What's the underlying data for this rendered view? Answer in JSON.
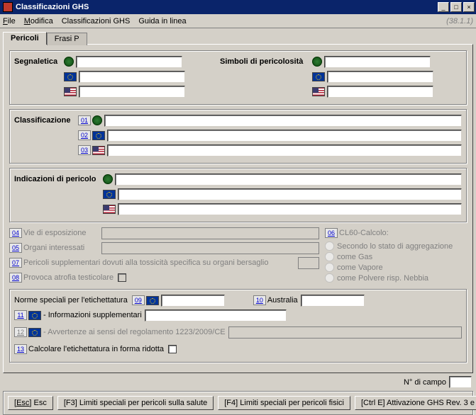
{
  "window": {
    "title": "Classificazioni GHS",
    "version": "(38.1.1)"
  },
  "menu": {
    "file": "File",
    "edit": "Modifica",
    "ghs": "Classificazioni GHS",
    "help": "Guida in linea"
  },
  "tabs": {
    "pericoli": "Pericoli",
    "frasip": "Frasi P"
  },
  "labels": {
    "segnaletica": "Segnaletica",
    "simboli": "Simboli di pericolosità",
    "classificazione": "Classificazione",
    "indicazioni": "Indicazioni di pericolo",
    "vie": "Vie di esposizione",
    "organi": "Organi interessati",
    "perisup": "Pericoli supplementari dovuti alla tossicità specifica su organi bersaglio",
    "provoca": "Provoca atrofia testicolare",
    "cl60": "CL60-Calcolo:",
    "rad1": "Secondo lo stato di aggregazione",
    "rad2": "come Gas",
    "rad3": "come Vapore",
    "rad4": "come Polvere risp. Nebbia",
    "norme": "Norme speciali per l'etichettatura",
    "australia": "Australia",
    "infosup": "- Informazioni supplementari",
    "avvert": "- Avvertenze ai sensi del regolamento 1223/2009/CE",
    "calcrid": "Calcolare l'etichettatura in forma ridotta",
    "ncampo": "N° di campo"
  },
  "idx": {
    "c1": "01",
    "c2": "02",
    "c3": "03",
    "v4": "04",
    "v5": "05",
    "v6": "06",
    "v7": "07",
    "v8": "08",
    "v9": "09",
    "v10": "10",
    "v11": "11",
    "v12": "12",
    "v13": "13"
  },
  "buttons": {
    "esc": "[Esc] Esc",
    "f3": "[F3] Limiti speciali per pericoli sulla salute",
    "f4": "[F4] Limiti speciali per pericoli fisici",
    "ctrle": "[Ctrl E] Attivazione GHS Rev. 3 e CLP 2° ATP"
  }
}
